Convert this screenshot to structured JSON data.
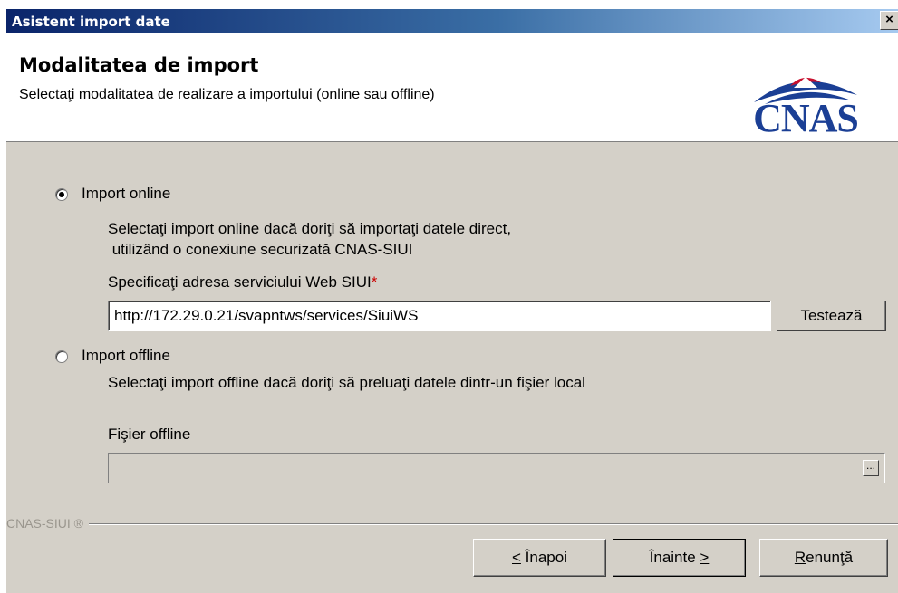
{
  "window": {
    "title": "Asistent import date",
    "close_label": "×"
  },
  "header": {
    "heading": "Modalitatea de import",
    "subheading": "Selectaţi modalitatea de realizare a importului (online sau offline)",
    "logo_text": "CNAS"
  },
  "online": {
    "option_label": "Import online",
    "selected": true,
    "description_line1": "Selectaţi import online dacă doriţi să importaţi datele direct,",
    "description_line2": " utilizând o conexiune securizată CNAS-SIUI",
    "address_label": "Specificaţi adresa serviciului Web SIUI",
    "required_mark": "*",
    "address_value": "http://172.29.0.21/svapntws/services/SiuiWS",
    "test_button": "Testează"
  },
  "offline": {
    "option_label": "Import offline",
    "selected": false,
    "description": "Selectaţi import offline dacă doriţi să preluaţi datele dintr-un fişier local",
    "file_label": "Fişier offline",
    "file_value": "",
    "browse_label": "..."
  },
  "footer": {
    "brand": "CNAS-SIUI ®",
    "back_button": {
      "hotkey": "<",
      "label": " Înapoi"
    },
    "next_button": {
      "label": "Înainte ",
      "hotkey": ">"
    },
    "cancel_button": {
      "hotkey": "R",
      "label": "enunţă"
    }
  },
  "colors": {
    "title_bar": "#0a246a",
    "dialog_bg": "#d4d0c8",
    "logo": "#1b3f95",
    "required": "#cc0000"
  }
}
